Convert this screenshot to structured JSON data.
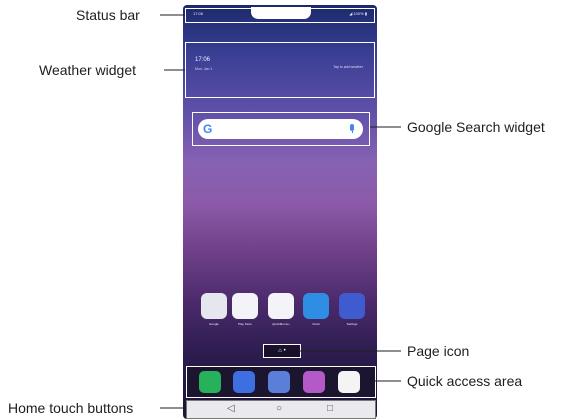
{
  "callouts": {
    "status_bar": "Status bar",
    "weather_widget": "Weather widget",
    "google_search_widget": "Google Search widget",
    "page_icon": "Page icon",
    "quick_access_area": "Quick access area",
    "home_touch_buttons": "Home touch buttons"
  },
  "phone": {
    "status_time": "17:06",
    "status_right": "◢ 100% ▮",
    "weather_time": "17:06",
    "weather_date": "Mon, Jan 1",
    "weather_hint": "Tap to add weather",
    "home_apps": [
      {
        "label": "Google",
        "icon": "google-folder-icon",
        "color": "#e6e6ee"
      },
      {
        "label": "Play Store",
        "icon": "play-store-icon",
        "color": "#f4f4f8"
      },
      {
        "label": "QuickMemo+",
        "icon": "quickmemo-icon",
        "color": "#f4f4f8"
      },
      {
        "label": "Clock",
        "icon": "clock-icon",
        "color": "#2f8de4"
      },
      {
        "label": "Settings",
        "icon": "settings-icon",
        "color": "#3f5bd0"
      }
    ],
    "dock_apps": [
      {
        "icon": "phone-icon",
        "color": "#27b15a"
      },
      {
        "icon": "messages-icon",
        "color": "#3d6fe0"
      },
      {
        "icon": "camera-icon",
        "color": "#5b7fd8"
      },
      {
        "icon": "gallery-icon",
        "color": "#b45ac8"
      },
      {
        "icon": "chrome-icon",
        "color": "#f4f4f4"
      }
    ],
    "nav_buttons": [
      {
        "icon": "back-icon",
        "glyph": "◁"
      },
      {
        "icon": "home-icon",
        "glyph": "○"
      },
      {
        "icon": "recents-icon",
        "glyph": "□"
      }
    ],
    "page_indicator": "⌂ •"
  }
}
